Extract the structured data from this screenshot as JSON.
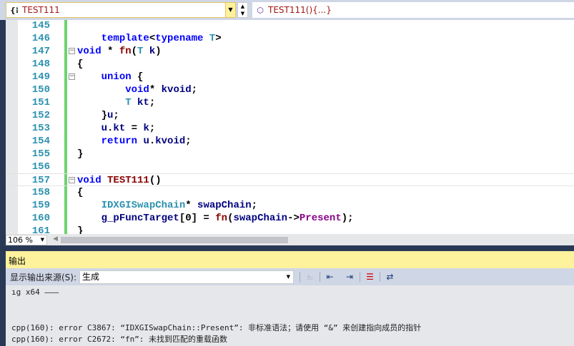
{
  "nav": {
    "scope": "TEST111",
    "member": "TEST111(){...}"
  },
  "editor": {
    "lines": [
      {
        "n": "145",
        "t": []
      },
      {
        "n": "146",
        "t": [
          [
            "    ",
            "pl"
          ],
          [
            "template",
            "kw"
          ],
          [
            "<",
            "pl"
          ],
          [
            "typename",
            "kw"
          ],
          [
            " ",
            "pl"
          ],
          [
            "T",
            "ty"
          ],
          [
            ">",
            "pl"
          ]
        ],
        "fold": ""
      },
      {
        "n": "147",
        "t": [
          [
            "void",
            "kw"
          ],
          [
            " * ",
            "pl"
          ],
          [
            "fn",
            "fn"
          ],
          [
            "(",
            "pl"
          ],
          [
            "T",
            "ty"
          ],
          [
            " ",
            "pl"
          ],
          [
            "k",
            "id"
          ],
          [
            ")",
            "pl"
          ]
        ],
        "fold": "−"
      },
      {
        "n": "148",
        "t": [
          [
            "{",
            "pl"
          ]
        ]
      },
      {
        "n": "149",
        "t": [
          [
            "    ",
            "pl"
          ],
          [
            "union",
            "kw"
          ],
          [
            " {",
            "pl"
          ]
        ],
        "fold": "−"
      },
      {
        "n": "150",
        "t": [
          [
            "        ",
            "pl"
          ],
          [
            "void",
            "kw"
          ],
          [
            "* ",
            "pl"
          ],
          [
            "kvoid",
            "id"
          ],
          [
            ";",
            "pl"
          ]
        ]
      },
      {
        "n": "151",
        "t": [
          [
            "        ",
            "pl"
          ],
          [
            "T",
            "ty"
          ],
          [
            " ",
            "pl"
          ],
          [
            "kt",
            "id"
          ],
          [
            ";",
            "pl"
          ]
        ]
      },
      {
        "n": "152",
        "t": [
          [
            "    }",
            "pl"
          ],
          [
            "u",
            "id"
          ],
          [
            ";",
            "pl"
          ]
        ]
      },
      {
        "n": "153",
        "t": [
          [
            "    ",
            "pl"
          ],
          [
            "u",
            "id"
          ],
          [
            ".",
            "pl"
          ],
          [
            "kt",
            "id"
          ],
          [
            " = ",
            "pl"
          ],
          [
            "k",
            "id"
          ],
          [
            ";",
            "pl"
          ]
        ]
      },
      {
        "n": "154",
        "t": [
          [
            "    ",
            "pl"
          ],
          [
            "return",
            "kw"
          ],
          [
            " ",
            "pl"
          ],
          [
            "u",
            "id"
          ],
          [
            ".",
            "pl"
          ],
          [
            "kvoid",
            "id"
          ],
          [
            ";",
            "pl"
          ]
        ]
      },
      {
        "n": "155",
        "t": [
          [
            "}",
            "pl"
          ]
        ]
      },
      {
        "n": "156",
        "t": []
      },
      {
        "n": "157",
        "t": [
          [
            "void",
            "kw"
          ],
          [
            " ",
            "pl"
          ],
          [
            "TEST111",
            "fn"
          ],
          [
            "()",
            "pl"
          ]
        ],
        "fold": "−",
        "current": true
      },
      {
        "n": "158",
        "t": [
          [
            "{",
            "pl"
          ]
        ]
      },
      {
        "n": "159",
        "t": [
          [
            "    ",
            "pl"
          ],
          [
            "IDXGISwapChain",
            "ty"
          ],
          [
            "* ",
            "pl"
          ],
          [
            "swapChain",
            "id"
          ],
          [
            ";",
            "pl"
          ]
        ]
      },
      {
        "n": "160",
        "t": [
          [
            "    ",
            "pl"
          ],
          [
            "g_pFuncTarget",
            "id"
          ],
          [
            "[0] = ",
            "pl"
          ],
          [
            "fn",
            "fn"
          ],
          [
            "(",
            "pl"
          ],
          [
            "swapChain",
            "id"
          ],
          [
            "->",
            "pl"
          ],
          [
            "Present",
            "mb"
          ],
          [
            ");",
            "pl"
          ]
        ]
      },
      {
        "n": "161",
        "t": [
          [
            "}",
            "pl"
          ]
        ]
      }
    ],
    "zoom": "106 %"
  },
  "output": {
    "title": "输出",
    "source_label": "显示输出来源(S):",
    "source_value": "生成",
    "lines": [
      "ıg x64 ———",
      "",
      "",
      "cpp(160): error C3867: “IDXGISwapChain::Present”: 非标准语法；请使用 “&” 来创建指向成员的指针",
      "cpp(160): error C2672: “fn”: 未找到匹配的重载函数"
    ]
  }
}
